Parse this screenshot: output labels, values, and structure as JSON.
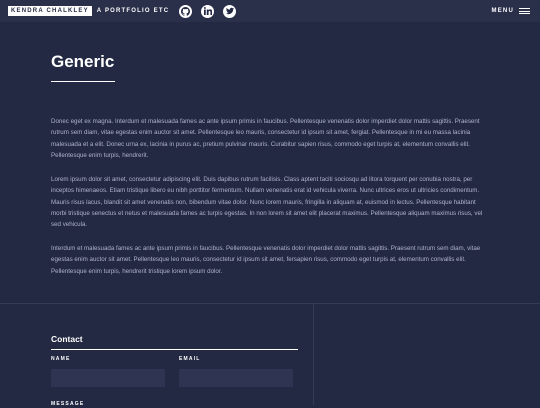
{
  "header": {
    "logo_name": "KENDRA CHALKLEY",
    "logo_tagline": "A PORTFOLIO ETC",
    "social": [
      "github-icon",
      "linkedin-icon",
      "twitter-icon"
    ],
    "menu_label": "MENU"
  },
  "main": {
    "title": "Generic",
    "paragraphs": [
      "Donec eget ex magna. Interdum et malesuada fames ac ante ipsum primis in faucibus. Pellentesque venenatis dolor imperdiet dolor mattis sagittis. Praesent rutrum sem diam, vitae egestas enim auctor sit amet. Pellentesque leo mauris, consectetur id ipsum sit amet, fergiat. Pellentesque in mi eu massa lacinia malesuada et a elit. Donec urna ex, lacinia in purus ac, pretium pulvinar mauris. Curabitur sapien risus, commodo eget turpis at, elementum convallis elit. Pellentesque enim turpis, hendrerit.",
      "Lorem ipsum dolor sit amet, consectetur adipiscing elit. Duis dapibus rutrum facilisis. Class aptent taciti sociosqu ad litora torquent per conubia nostra, per inceptos himenaeos. Etiam tristique libero eu nibh porttitor fermentum. Nullam venenatis erat id vehicula viverra. Nunc ultrices eros ut ultricies condimentum. Mauris risus lacus, blandit sit amet venenatis non, bibendum vitae dolor. Nunc lorem mauris, fringilla in aliquam at, euismod in lectus. Pellentesque habitant morbi tristique senectus et netus et malesuada fames ac turpis egestas. In non lorem sit amet elit placerat maximus. Pellentesque aliquam maximus risus, vel sed vehicula.",
      "Interdum et malesuada fames ac ante ipsum primis in faucibus. Pellentesque venenatis dolor imperdiet dolor mattis sagittis. Praesent rutrum sem diam, vitae egestas enim auctor sit amet. Pellentesque leo mauris, consectetur id ipsum sit amet, fersapien risus, commodo eget turpis at, elementum convallis elit. Pellentesque enim turpis, hendrerit tristique lorem ipsum dolor."
    ]
  },
  "footer": {
    "contact_title": "Contact",
    "name_label": "NAME",
    "email_label": "EMAIL",
    "message_label": "MESSAGE",
    "name_value": "",
    "email_value": ""
  },
  "colors": {
    "background": "#242943",
    "header": "#2a2f4a",
    "text": "#ffffff",
    "body_text": "#aeb2c9",
    "field": "#2f3452"
  }
}
